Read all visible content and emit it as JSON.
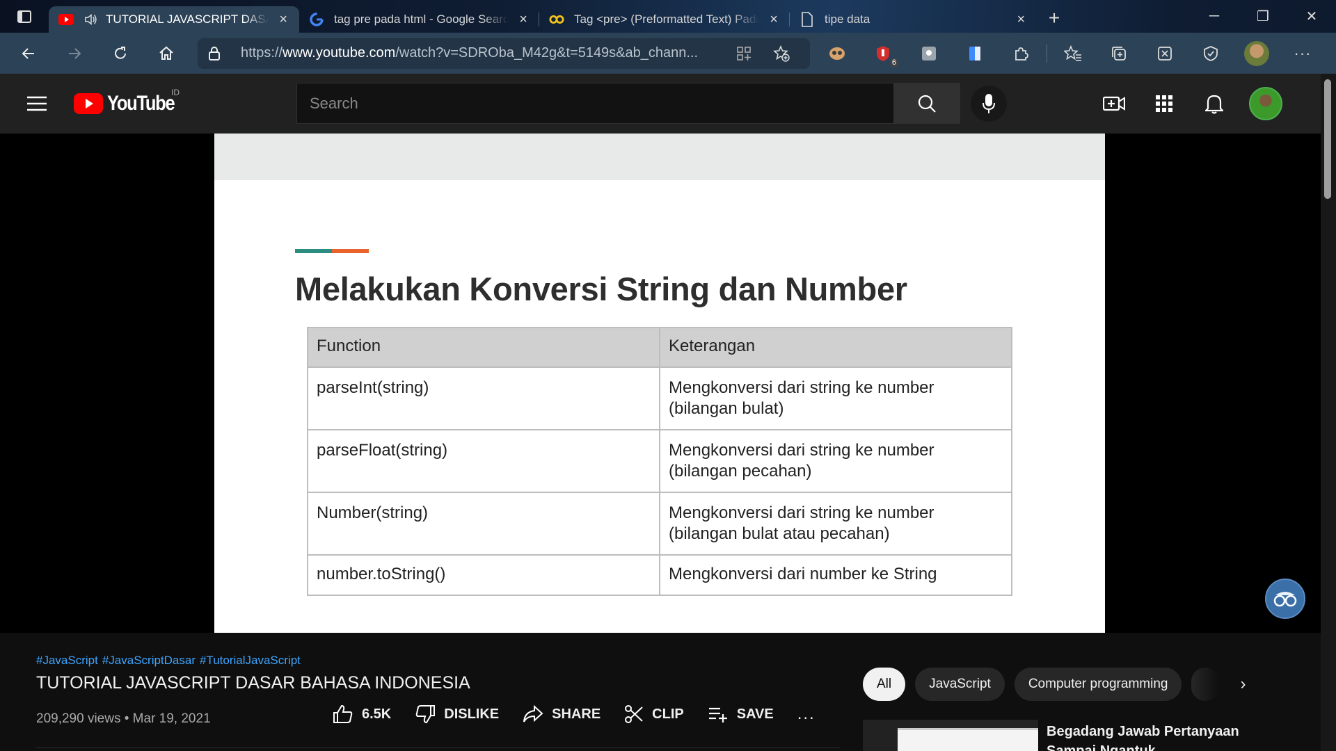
{
  "browser": {
    "tabs": [
      {
        "title": "TUTORIAL JAVASCRIPT DASAR BAHASA INDONESIA",
        "favicon": "youtube-icon",
        "active": true,
        "audio": true
      },
      {
        "title": "tag pre pada html - Google Search",
        "favicon": "google-icon",
        "active": false
      },
      {
        "title": "Tag <pre> (Preformatted Text) Pada HTML",
        "favicon": "site-icon",
        "active": false
      },
      {
        "title": "tipe data",
        "favicon": "page-icon",
        "active": false
      }
    ],
    "url_prefix": "https://",
    "url_domain": "www.youtube.com",
    "url_rest": "/watch?v=SDROba_M42g&t=5149s&ab_chann...",
    "extension_badge": "6"
  },
  "youtube": {
    "logo_text": "YouTube",
    "region": "ID",
    "search_placeholder": "Search"
  },
  "slide": {
    "title": "Melakukan Konversi String dan Number",
    "headers": [
      "Function",
      "Keterangan"
    ],
    "rows": [
      {
        "fn": "parseInt(string)",
        "desc1": "Mengkonversi dari string ke number",
        "desc2": "(bilangan bulat)"
      },
      {
        "fn": "parseFloat(string)",
        "desc1": "Mengkonversi dari string ke number",
        "desc2": "(bilangan pecahan)"
      },
      {
        "fn": "Number(string)",
        "desc1": "Mengkonversi dari string ke number",
        "desc2": "(bilangan bulat atau pecahan)"
      },
      {
        "fn": "number.toString()",
        "desc1": "Mengkonversi dari number ke String",
        "desc2": ""
      }
    ]
  },
  "video": {
    "hashtags": [
      "#JavaScript",
      "#JavaScriptDasar",
      "#TutorialJavaScript"
    ],
    "title": "TUTORIAL JAVASCRIPT DASAR BAHASA INDONESIA",
    "meta": "209,290 views • Mar 19, 2021",
    "actions": {
      "like": "6.5K",
      "dislike": "DISLIKE",
      "share": "SHARE",
      "clip": "CLIP",
      "save": "SAVE",
      "more": "..."
    }
  },
  "sidebar": {
    "chips": [
      "All",
      "JavaScript",
      "Computer programming"
    ],
    "recommendation_title": "Begadang Jawab Pertanyaan Sampai Ngantuk"
  },
  "colors": {
    "youtube_red": "#ff0000",
    "link_blue": "#3ea6ff",
    "accent_teal": "#2b8c80",
    "accent_orange": "#e8642c"
  }
}
